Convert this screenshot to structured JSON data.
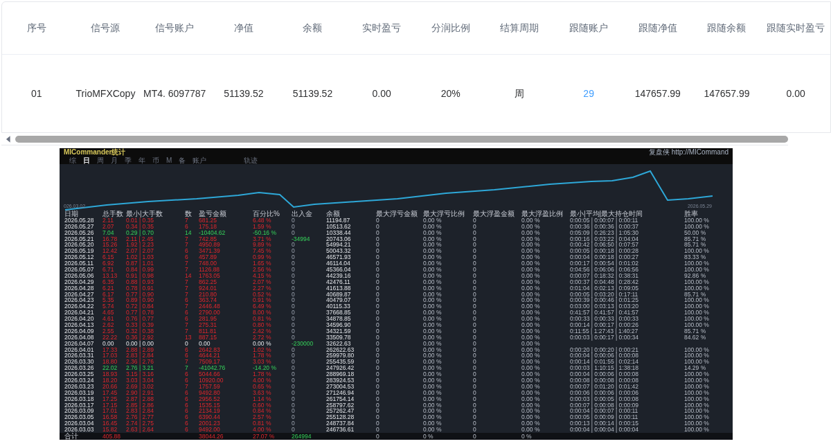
{
  "table": {
    "columns": [
      {
        "label": "序号",
        "kind": "text"
      },
      {
        "label": "信号源",
        "kind": "text"
      },
      {
        "label": "信号账户",
        "kind": "text"
      },
      {
        "label": "净值",
        "kind": "text"
      },
      {
        "label": "余额",
        "kind": "text"
      },
      {
        "label": "实时盈亏",
        "kind": "text"
      },
      {
        "label": "分润比例",
        "kind": "text"
      },
      {
        "label": "结算周期",
        "kind": "text"
      },
      {
        "label": "跟随账户",
        "kind": "link"
      },
      {
        "label": "跟随净值",
        "kind": "text"
      },
      {
        "label": "跟随余额",
        "kind": "text"
      },
      {
        "label": "跟随实时盈亏",
        "kind": "text"
      }
    ],
    "rows": [
      [
        "01",
        "TrioMFXCopy",
        "MT4. 6097787",
        "51139.52",
        "51139.52",
        "0.00",
        "20%",
        "周",
        "29",
        "147657.99",
        "147657.99",
        "0.00"
      ]
    ]
  },
  "stats_screenshot": {
    "title": "MICommander统计",
    "brand": "复盘侠 http://MICommand",
    "tabs": [
      {
        "label": "综",
        "selected": false
      },
      {
        "label": "日",
        "selected": true
      },
      {
        "label": "周",
        "selected": false
      },
      {
        "label": "月",
        "selected": false
      },
      {
        "label": "季",
        "selected": false
      },
      {
        "label": "年",
        "selected": false
      },
      {
        "label": "币",
        "selected": false
      },
      {
        "label": "M",
        "selected": false
      },
      {
        "label": "备",
        "selected": false
      },
      {
        "label": "账户",
        "selected": false
      },
      {
        "label": "轨迹",
        "selected": false
      }
    ],
    "chart_start": "026.03.02",
    "chart_end": "2026.05.29",
    "columns": [
      "日期",
      "总手数",
      "最小|大手数",
      "数",
      "盈亏金额",
      "百分比%",
      "出入金",
      "余额",
      "最大浮亏金额",
      "最大浮亏比例",
      "最大浮盈金额",
      "最大浮盈比例",
      "最小|平均|最大持仓时间",
      "胜率"
    ],
    "rows": [
      {
        "kind": "gain",
        "transfer_highlight": false,
        "cells": [
          "2026.05.28",
          "2.11",
          "0.01 | 0.35",
          "7",
          "681.25",
          "6.48 %",
          "0",
          "11194.87",
          "0",
          "0.00 %",
          "0",
          "0.00 %",
          "0:00:05 | 0:00:07 | 0:00:11",
          "100.00 %"
        ]
      },
      {
        "kind": "gain",
        "transfer_highlight": false,
        "cells": [
          "2026.05.27",
          "2.07",
          "0.34 | 0.35",
          "6",
          "175.18",
          "1.59 %",
          "0",
          "10513.62",
          "0",
          "0.00 %",
          "0",
          "0.00 %",
          "0:00:36 | 0:00:36 | 0:00:37",
          "100.00 %"
        ]
      },
      {
        "kind": "loss",
        "transfer_highlight": false,
        "cells": [
          "2026.05.26",
          "7.04",
          "0.29 | 0.70",
          "14",
          "-10404.62",
          "-50.16 %",
          "0",
          "10338.44",
          "0",
          "0.00 %",
          "0",
          "0.00 %",
          "0:05:09 | 0:26:23 | 1:05:30",
          "50.00 %"
        ]
      },
      {
        "kind": "gain",
        "transfer_highlight": true,
        "cells": [
          "2026.05.21",
          "16.78",
          "2.11 | 2.45",
          "7",
          "742.85",
          "3.71 %",
          "-34994",
          "20743.06",
          "0",
          "0.00 %",
          "0",
          "0.00 %",
          "0:00:16 | 0:03:22 | 0:04:04",
          "85.71 %"
        ]
      },
      {
        "kind": "gain",
        "transfer_highlight": false,
        "cells": [
          "2026.05.20",
          "15.26",
          "1.92 | 2.23",
          "7",
          "4950.89",
          "9.89 %",
          "0",
          "54994.21",
          "0",
          "0.00 %",
          "0",
          "0.00 %",
          "0:00:42 | 0:06:50 | 0:07:57",
          "85.71 %"
        ]
      },
      {
        "kind": "gain",
        "transfer_highlight": false,
        "cells": [
          "2026.05.19",
          "12.42",
          "2.07 | 2.07",
          "6",
          "3471.39",
          "7.45 %",
          "0",
          "50043.32",
          "0",
          "0.00 %",
          "0",
          "0.00 %",
          "0:00:05 | 0:00:18 | 0:00:28",
          "100.00 %"
        ]
      },
      {
        "kind": "gain",
        "transfer_highlight": false,
        "cells": [
          "2026.05.12",
          "6.15",
          "1.02 | 1.03",
          "6",
          "457.89",
          "0.99 %",
          "0",
          "46571.93",
          "0",
          "0.00 %",
          "0",
          "0.00 %",
          "0:00:04 | 0:00:18 | 0:00:27",
          "83.33 %"
        ]
      },
      {
        "kind": "gain",
        "transfer_highlight": false,
        "cells": [
          "2026.05.11",
          "6.92",
          "0.87 | 1.01",
          "7",
          "748.00",
          "1.65 %",
          "0",
          "46114.04",
          "0",
          "0.00 %",
          "0",
          "0.00 %",
          "0:00:17 | 0:00:54 | 0:01:02",
          "100.00 %"
        ]
      },
      {
        "kind": "gain",
        "transfer_highlight": false,
        "cells": [
          "2026.05.07",
          "6.71",
          "0.84 | 0.99",
          "7",
          "1126.88",
          "2.56 %",
          "0",
          "45366.04",
          "0",
          "0.00 %",
          "0",
          "0.00 %",
          "0:04:56 | 0:06:06 | 0:06:56",
          "100.00 %"
        ]
      },
      {
        "kind": "gain",
        "transfer_highlight": false,
        "cells": [
          "2026.05.06",
          "13.13",
          "0.91 | 0.98",
          "14",
          "1763.05",
          "4.15 %",
          "0",
          "44239.16",
          "0",
          "0.00 %",
          "0",
          "0.00 %",
          "0:00:07 | 0:18:32 | 0:38:31",
          "92.86 %"
        ]
      },
      {
        "kind": "gain",
        "transfer_highlight": false,
        "cells": [
          "2026.04.29",
          "6.35",
          "0.88 | 0.93",
          "7",
          "862.25",
          "2.07 %",
          "0",
          "42476.11",
          "0",
          "0.00 %",
          "0",
          "0.00 %",
          "0:00:37 | 0:04:48 | 0:28:42",
          "100.00 %"
        ]
      },
      {
        "kind": "gain",
        "transfer_highlight": false,
        "cells": [
          "2026.04.28",
          "6.21",
          "0.78 | 0.91",
          "7",
          "924.01",
          "2.27 %",
          "0",
          "41613.88",
          "0",
          "0.00 %",
          "0",
          "0.00 %",
          "0:01:04 | 0:02:13 | 0:09:05",
          "100.00 %"
        ]
      },
      {
        "kind": "gain",
        "transfer_highlight": false,
        "cells": [
          "2026.04.27",
          "6.17",
          "0.77 | 0.90",
          "7",
          "210.80",
          "0.52 %",
          "0",
          "40689.87",
          "0",
          "0.00 %",
          "0",
          "0.00 %",
          "0:00:05 | 0:03:20 | 0:17:11",
          "85.71 %"
        ]
      },
      {
        "kind": "gain",
        "transfer_highlight": false,
        "cells": [
          "2026.04.23",
          "5.35",
          "0.89 | 0.90",
          "6",
          "363.74",
          "0.91 %",
          "0",
          "40479.07",
          "0",
          "0.00 %",
          "0",
          "0.00 %",
          "0:00:39 | 0:00:46 | 0:01:25",
          "100.00 %"
        ]
      },
      {
        "kind": "gain",
        "transfer_highlight": false,
        "cells": [
          "2026.04.22",
          "5.74",
          "0.72 | 0.84",
          "7",
          "2446.48",
          "6.49 %",
          "0",
          "40115.33",
          "0",
          "0.00 %",
          "0",
          "0.00 %",
          "0:03:00 | 0:03:13 | 0:03:20",
          "100.00 %"
        ]
      },
      {
        "kind": "gain",
        "transfer_highlight": false,
        "cells": [
          "2026.04.21",
          "4.65",
          "0.77 | 0.78",
          "6",
          "2790.00",
          "8.00 %",
          "0",
          "37668.85",
          "0",
          "0.00 %",
          "0",
          "0.00 %",
          "0:41:57 | 0:41:57 | 0:41:57",
          "100.00 %"
        ]
      },
      {
        "kind": "gain",
        "transfer_highlight": false,
        "cells": [
          "2026.04.20",
          "4.61",
          "0.76 | 0.77",
          "6",
          "281.95",
          "0.81 %",
          "0",
          "34878.85",
          "0",
          "0.00 %",
          "0",
          "0.00 %",
          "0:00:33 | 0:00:33 | 0:00:33",
          "100.00 %"
        ]
      },
      {
        "kind": "gain",
        "transfer_highlight": false,
        "cells": [
          "2026.04.13",
          "2.62",
          "0.33 | 0.39",
          "7",
          "275.31",
          "0.80 %",
          "0",
          "34596.90",
          "0",
          "0.00 %",
          "0",
          "0.00 %",
          "0:00:14 | 0:00:17 | 0:00:26",
          "100.00 %"
        ]
      },
      {
        "kind": "gain",
        "transfer_highlight": false,
        "cells": [
          "2026.04.09",
          "2.55",
          "0.32 | 0.38",
          "7",
          "811.81",
          "2.42 %",
          "0",
          "34321.59",
          "0",
          "0.00 %",
          "0",
          "0.00 %",
          "0:11:55 | 1:27:43 | 1:40:27",
          "85.71 %"
        ]
      },
      {
        "kind": "gain",
        "transfer_highlight": false,
        "cells": [
          "2026.04.08",
          "22.22",
          "0.36 | 2.92",
          "13",
          "887.15",
          "2.72 %",
          "0",
          "33509.78",
          "0",
          "0.00 %",
          "0",
          "0.00 %",
          "0:00:03 | 0:00:17 | 0:00:34",
          "84.62 %"
        ]
      },
      {
        "kind": "flat",
        "transfer_highlight": true,
        "cells": [
          "2026.04.07",
          "0.00",
          "0.00 | 0.00",
          "0",
          "0.00",
          "0.00 %",
          "-230000",
          "32622.63",
          "0",
          "0.00 %",
          "0",
          "0.00 %"
        ]
      },
      {
        "kind": "gain",
        "transfer_highlight": false,
        "cells": [
          "2026.04.01",
          "17.33",
          "2.88 | 2.89",
          "6",
          "2642.83",
          "1.02 %",
          "0",
          "262622.63",
          "0",
          "0.00 %",
          "0",
          "0.00 %",
          "0:00:20 | 0:00:20 | 0:00:21",
          "100.00 %"
        ]
      },
      {
        "kind": "gain",
        "transfer_highlight": false,
        "cells": [
          "2026.03.31",
          "17.03",
          "2.83 | 2.84",
          "6",
          "4644.21",
          "1.78 %",
          "0",
          "259979.80",
          "0",
          "0.00 %",
          "0",
          "0.00 %",
          "0:00:04 | 0:00:06 | 0:00:08",
          "100.00 %"
        ]
      },
      {
        "kind": "gain",
        "transfer_highlight": false,
        "cells": [
          "2026.03.30",
          "18.80",
          "2.36 | 2.76",
          "7",
          "7509.17",
          "3.03 %",
          "0",
          "255435.59",
          "0",
          "0.00 %",
          "0",
          "0.00 %",
          "0:00:14 | 0:01:55 | 0:02:14",
          "100.00 %"
        ]
      },
      {
        "kind": "loss",
        "transfer_highlight": false,
        "cells": [
          "2026.03.26",
          "22.02",
          "2.76 | 3.21",
          "7",
          "-41042.76",
          "-14.20 %",
          "0",
          "247926.42",
          "0",
          "0.00 %",
          "0",
          "0.00 %",
          "0:00:03 | 1:10:15 | 1:38:18",
          "14.29 %"
        ]
      },
      {
        "kind": "gain",
        "transfer_highlight": false,
        "cells": [
          "2026.03.25",
          "18.93",
          "3.15 | 3.16",
          "6",
          "5044.66",
          "1.78 %",
          "0",
          "288969.18",
          "0",
          "0.00 %",
          "0",
          "0.00 %",
          "0:00:04 | 0:00:06 | 0:00:08",
          "100.00 %"
        ]
      },
      {
        "kind": "gain",
        "transfer_highlight": false,
        "cells": [
          "2026.03.24",
          "18.20",
          "3.03 | 3.04",
          "6",
          "10920.00",
          "4.00 %",
          "0",
          "283924.53",
          "0",
          "0.00 %",
          "0",
          "0.00 %",
          "0:00:08 | 0:00:08 | 0:00:08",
          "100.00 %"
        ]
      },
      {
        "kind": "gain",
        "transfer_highlight": false,
        "cells": [
          "2026.03.23",
          "20.66",
          "2.69 | 3.02",
          "7",
          "1757.59",
          "0.65 %",
          "0",
          "273004.53",
          "0",
          "0.00 %",
          "0",
          "0.00 %",
          "0:00:07 | 0:01:20 | 0:01:42",
          "100.00 %"
        ]
      },
      {
        "kind": "gain",
        "transfer_highlight": false,
        "cells": [
          "2026.03.19",
          "17.45",
          "2.90 | 2.91",
          "6",
          "9492.80",
          "3.63 %",
          "0",
          "271246.94",
          "0",
          "0.00 %",
          "0",
          "0.00 %",
          "0:00:06 | 0:00:06 | 0:00:06",
          "100.00 %"
        ]
      },
      {
        "kind": "gain",
        "transfer_highlight": false,
        "cells": [
          "2026.03.18",
          "17.25",
          "2.87 | 2.88",
          "6",
          "2956.52",
          "1.14 %",
          "0",
          "261754.14",
          "0",
          "0.00 %",
          "0",
          "0.00 %",
          "0:00:03 | 0:00:05 | 0:00:08",
          "100.00 %"
        ]
      },
      {
        "kind": "gain",
        "transfer_highlight": false,
        "cells": [
          "2026.03.17",
          "17.15",
          "2.85 | 2.86",
          "6",
          "1535.15",
          "0.60 %",
          "0",
          "258797.62",
          "0",
          "0.00 %",
          "0",
          "0.00 %",
          "0:00:07 | 0:00:08 | 0:00:09",
          "100.00 %"
        ]
      },
      {
        "kind": "gain",
        "transfer_highlight": false,
        "cells": [
          "2026.03.09",
          "17.01",
          "2.83 | 2.84",
          "6",
          "2134.19",
          "0.84 %",
          "0",
          "257262.47",
          "0",
          "0.00 %",
          "0",
          "0.00 %",
          "0:00:04 | 0:00:07 | 0:00:11",
          "100.00 %"
        ]
      },
      {
        "kind": "gain",
        "transfer_highlight": false,
        "cells": [
          "2026.03.05",
          "16.58",
          "2.76 | 2.77",
          "6",
          "6390.44",
          "2.57 %",
          "0",
          "255128.28",
          "0",
          "0.00 %",
          "0",
          "0.00 %",
          "0:00:05 | 0:00:09 | 0:00:11",
          "100.00 %"
        ]
      },
      {
        "kind": "gain",
        "transfer_highlight": false,
        "cells": [
          "2026.03.04",
          "16.45",
          "2.74 | 2.75",
          "6",
          "2001.23",
          "0.81 %",
          "0",
          "248737.84",
          "0",
          "0.00 %",
          "0",
          "0.00 %",
          "0:00:13 | 0:00:14 | 0:00:15",
          "100.00 %"
        ]
      },
      {
        "kind": "gain",
        "transfer_highlight": false,
        "cells": [
          "2026.03.03",
          "15.82",
          "2.63 | 2.64",
          "6",
          "9492.00",
          "4.00 %",
          "0",
          "246736.61",
          "0",
          "0.00 %",
          "0",
          "0.00 %",
          "0:00:04 | 0:00:04 | 0:00:04",
          "100.00 %"
        ]
      }
    ],
    "total": {
      "label": "合计",
      "lots": "405.88",
      "pnl": "38044.26",
      "pct": "27.07 %",
      "transfer": "264994",
      "max_loss": "0",
      "max_loss_pct": "0 %",
      "max_gain": "0",
      "max_gain_pct": "0 %"
    }
  }
}
